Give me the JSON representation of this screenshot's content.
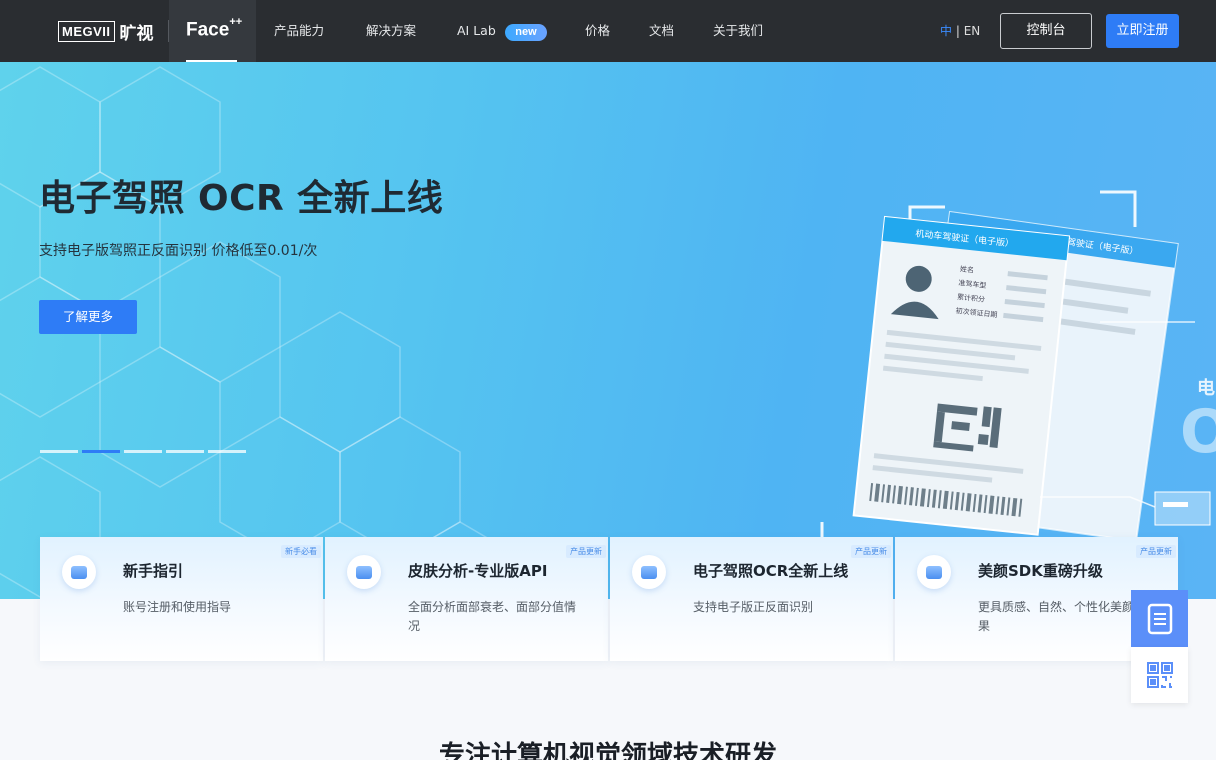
{
  "nav": {
    "logo_box": "MEGVII",
    "logo_cn": "旷视",
    "face_brand": "Face",
    "face_sup": "++",
    "items": [
      "产品能力",
      "解决方案",
      "AI Lab",
      "价格",
      "文档",
      "关于我们"
    ],
    "new_badge": "new",
    "lang_cn": "中",
    "lang_sep": " | ",
    "lang_en": "EN",
    "console_label": "控制台",
    "register_label": "立即注册"
  },
  "hero": {
    "title": "电子驾照 OCR 全新上线",
    "subtitle": "支持电子版驾照正反面识别 价格低至0.01/次",
    "button_label": "了解更多",
    "slide_count": 5,
    "active_slide": 2,
    "art": {
      "card_header": "机动车驾驶证（电子版）",
      "card_header_back": "驾驶证（电子版）",
      "fields": [
        "姓名",
        "准驾车型",
        "累计积分",
        "初次领证日期"
      ],
      "side_char": "电"
    }
  },
  "cards": [
    {
      "tag": "新手必看",
      "title": "新手指引",
      "desc": "账号注册和使用指导"
    },
    {
      "tag": "产品更新",
      "title": "皮肤分析-专业版API",
      "desc": "全面分析面部衰老、面部分值情况"
    },
    {
      "tag": "产品更新",
      "title": "电子驾照OCR全新上线",
      "desc": "支持电子版正反面识别"
    },
    {
      "tag": "产品更新",
      "title": "美颜SDK重磅升级",
      "desc": "更具质感、自然、个性化美颜效果"
    }
  ],
  "side_tools": {
    "doc_icon": "document-icon",
    "qr_icon": "qr-code-icon"
  },
  "section": {
    "title": "专注计算机视觉领域技术研发"
  },
  "colors": {
    "nav_bg": "#2a2d31",
    "accent": "#2e7cf6",
    "hero_start": "#5fd2ec",
    "hero_end": "#5ab4f5"
  }
}
